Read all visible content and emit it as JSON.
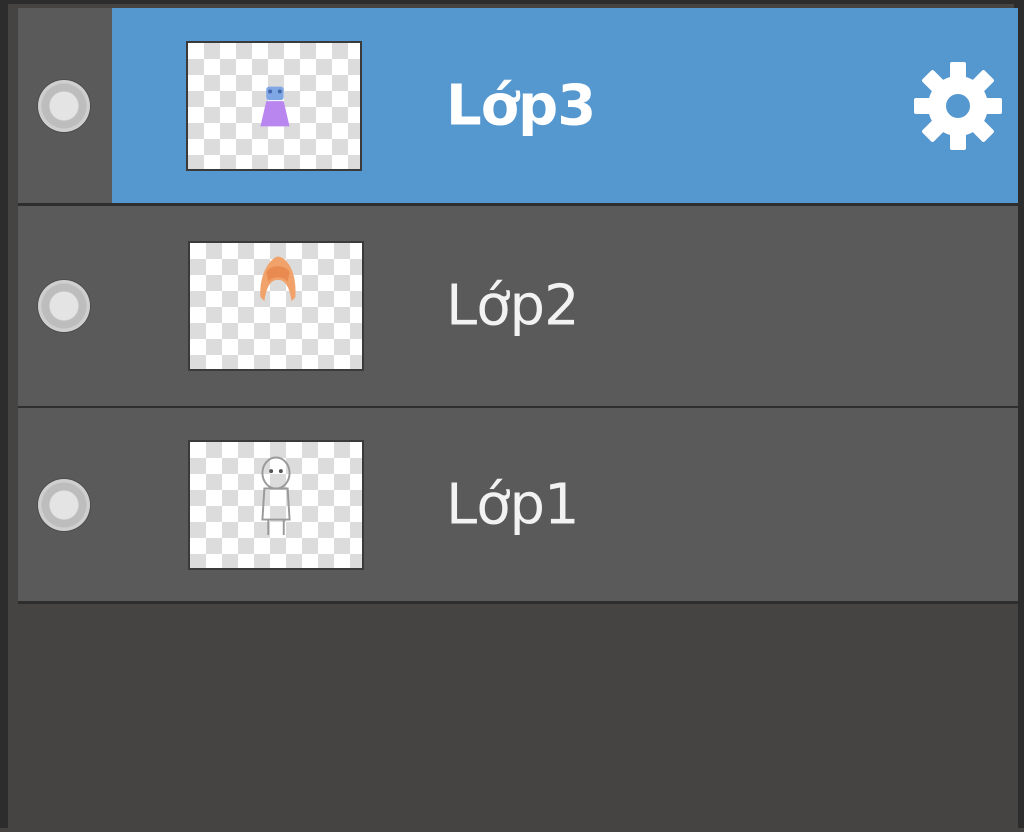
{
  "layers": [
    {
      "name": "Lớp3",
      "selected": true,
      "thumbnail_icon": "dress-sprite",
      "settings_icon": "gear-icon"
    },
    {
      "name": "Lớp2",
      "selected": false,
      "thumbnail_icon": "hair-sprite"
    },
    {
      "name": "Lớp1",
      "selected": false,
      "thumbnail_icon": "body-sketch-sprite"
    }
  ],
  "colors": {
    "selected_bg": "#5597cf",
    "row_bg": "#5b5a5a",
    "panel_bg": "#464442",
    "border": "#2c2c2c"
  }
}
